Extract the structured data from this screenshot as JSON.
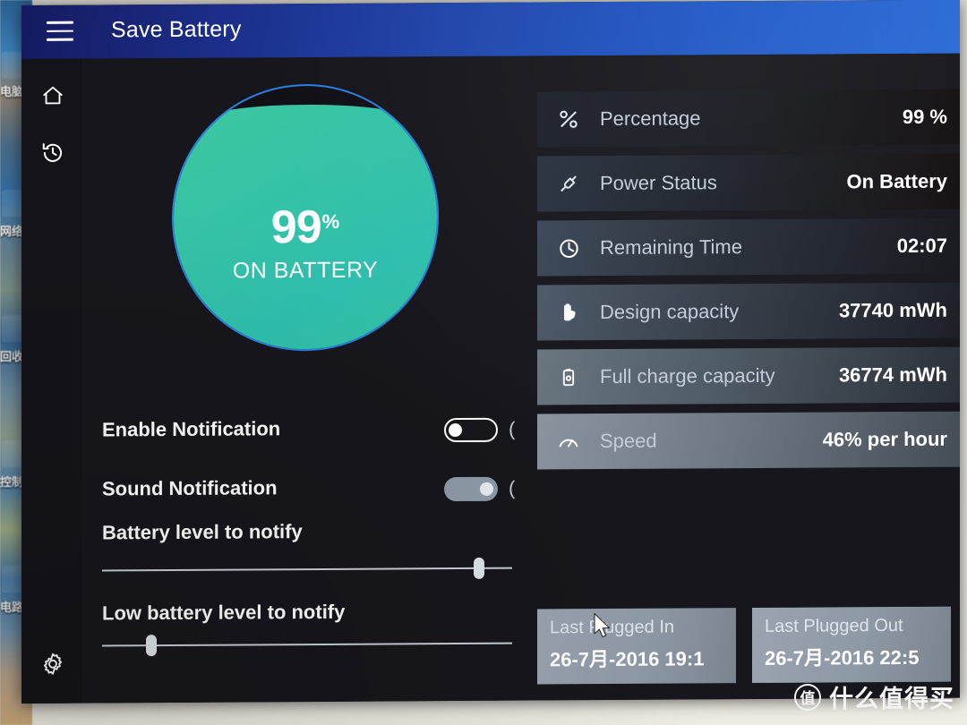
{
  "window": {
    "title": "Save Battery",
    "menu_icon": "hamburger-icon"
  },
  "nav": {
    "items": [
      {
        "id": "home",
        "icon": "home-icon",
        "label": "Home"
      },
      {
        "id": "history",
        "icon": "history-icon",
        "label": "History"
      },
      {
        "id": "settings",
        "icon": "gear-icon",
        "label": "Settings"
      }
    ]
  },
  "gauge": {
    "percent": "99",
    "percent_sign": "%",
    "status": "ON BATTERY",
    "fill_level": 93,
    "fill_color": "#33c3a5",
    "ring_color": "#2a7fe0"
  },
  "settings": {
    "enable_notification": {
      "label": "Enable Notification",
      "state": "off",
      "trailing_text": "("
    },
    "sound_notification": {
      "label": "Sound Notification",
      "state": "on",
      "trailing_text": "("
    },
    "battery_level_to_notify": {
      "label": "Battery level to notify",
      "value": 93
    },
    "low_battery_level_to_notify": {
      "label": "Low battery level to notify",
      "value": 11
    }
  },
  "info_rows": [
    {
      "icon": "percent-icon",
      "label": "Percentage",
      "value": "99 %"
    },
    {
      "icon": "power-plug-icon",
      "label": "Power Status",
      "value": "On Battery"
    },
    {
      "icon": "clock-icon",
      "label": "Remaining Time",
      "value": "02:07"
    },
    {
      "icon": "battery-shield-icon",
      "label": "Design capacity",
      "value": "37740 mWh"
    },
    {
      "icon": "battery-saver-icon",
      "label": "Full charge capacity",
      "value": "36774 mWh"
    },
    {
      "icon": "speedometer-icon",
      "label": "Speed",
      "value": "46% per hour"
    }
  ],
  "plugged_cards": [
    {
      "title": "Last Plugged In",
      "date": "26-7月-2016 19:1"
    },
    {
      "title": "Last Plugged Out",
      "date": "26-7月-2016 22:5"
    }
  ],
  "desktop_icons": [
    {
      "label": "电脑"
    },
    {
      "label": "网络"
    },
    {
      "label": "回收"
    },
    {
      "label": "控制面"
    },
    {
      "label": "电路"
    }
  ],
  "watermark": {
    "logo": "值",
    "text": "什么值得买"
  },
  "colors": {
    "titlebar_start": "#151a5e",
    "titlebar_end": "#2a6ad6",
    "app_background": "#16161c",
    "accent": "#2a7fe0",
    "battery_green": "#33c3a5"
  }
}
